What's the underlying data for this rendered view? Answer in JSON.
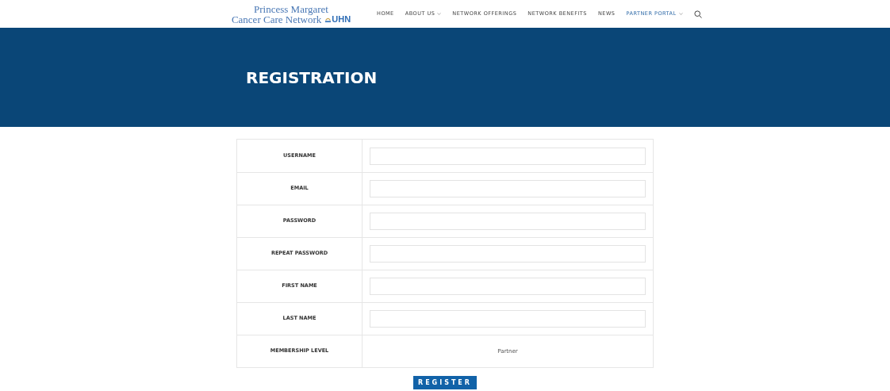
{
  "logo": {
    "line1": "Princess Margaret",
    "line2": "Cancer Care Network",
    "mark": "UHN"
  },
  "nav": [
    {
      "label": "HOME",
      "dropdown": false,
      "selected": false
    },
    {
      "label": "ABOUT US",
      "dropdown": true,
      "selected": false
    },
    {
      "label": "NETWORK OFFERINGS",
      "dropdown": false,
      "selected": false
    },
    {
      "label": "NETWORK BENEFITS",
      "dropdown": false,
      "selected": false
    },
    {
      "label": "NEWS",
      "dropdown": false,
      "selected": false
    },
    {
      "label": "PARTNER PORTAL",
      "dropdown": true,
      "selected": true
    }
  ],
  "banner": {
    "title": "REGISTRATION"
  },
  "form": {
    "rows": [
      {
        "label": "USERNAME",
        "kind": "input"
      },
      {
        "label": "EMAIL",
        "kind": "input"
      },
      {
        "label": "PASSWORD",
        "kind": "input"
      },
      {
        "label": "REPEAT PASSWORD",
        "kind": "input"
      },
      {
        "label": "FIRST NAME",
        "kind": "input"
      },
      {
        "label": "LAST NAME",
        "kind": "input"
      },
      {
        "label": "MEMBERSHIP LEVEL",
        "kind": "value",
        "value": "Partner"
      }
    ],
    "submit": "REGISTER"
  }
}
